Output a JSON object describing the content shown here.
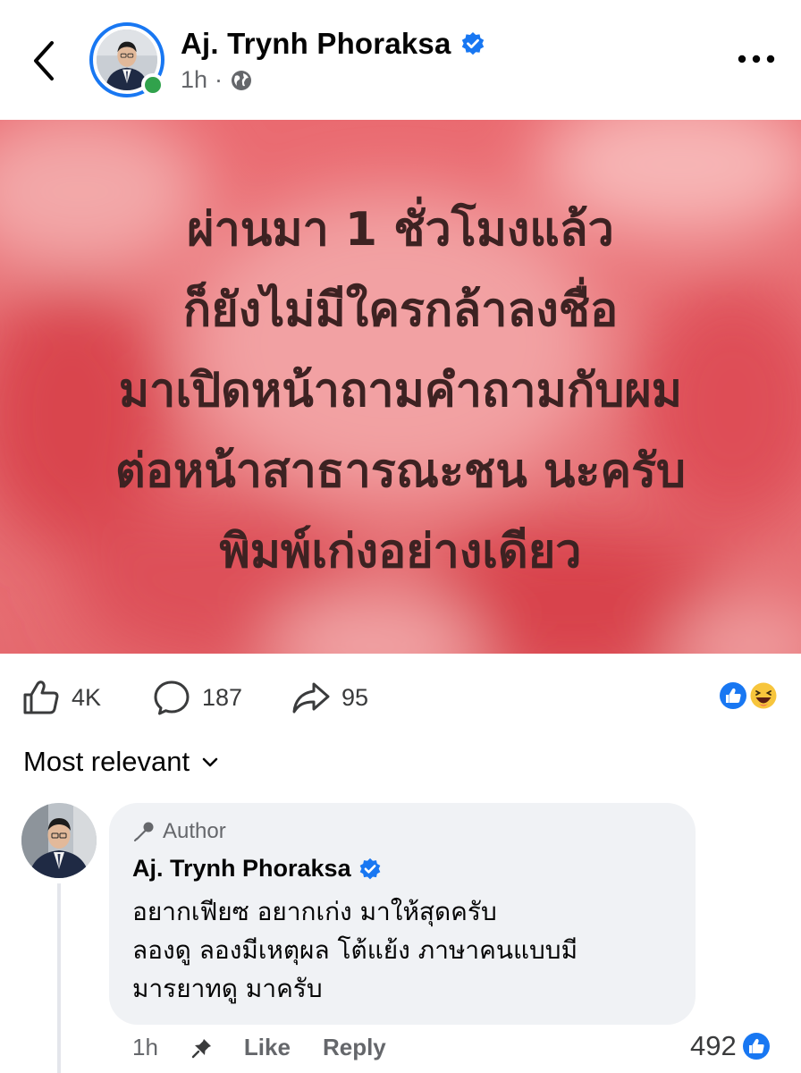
{
  "header": {
    "author_name": "Aj. Trynh Phoraksa",
    "time": "1h",
    "separator": "·",
    "audience_icon": "globe-icon",
    "verified_icon": "verified-badge-icon",
    "back_icon": "chevron-left-icon",
    "more_icon": "more-horizontal-icon"
  },
  "post": {
    "lines": [
      "ผ่านมา 1 ชั่วโมงแล้ว",
      "ก็ยังไม่มีใครกล้าลงชื่อ",
      "มาเปิดหน้าถามคำถามกับผม",
      "ต่อหน้าสาธารณะชน นะครับ",
      "พิมพ์เก่งอย่างเดียว"
    ],
    "background_color": "#e8646a"
  },
  "stats": {
    "likes": "4K",
    "comments": "187",
    "shares": "95",
    "reaction_icons": [
      "like-reaction-icon",
      "haha-reaction-icon"
    ]
  },
  "sort": {
    "label": "Most relevant"
  },
  "comment": {
    "badge": "Author",
    "author_name": "Aj. Trynh Phoraksa",
    "lines": [
      "อยากเฟียซ อยากเก่ง มาให้สุดครับ",
      "ลองดู ลองมีเหตุผล โต้แย้ง ภาษาคนแบบมี",
      "มารยาทดู มาครับ"
    ],
    "time": "1h",
    "like_label": "Like",
    "reply_label": "Reply",
    "reaction_count": "492"
  },
  "colors": {
    "accent": "#1877f2",
    "online": "#31a24c",
    "muted": "#65676b"
  }
}
